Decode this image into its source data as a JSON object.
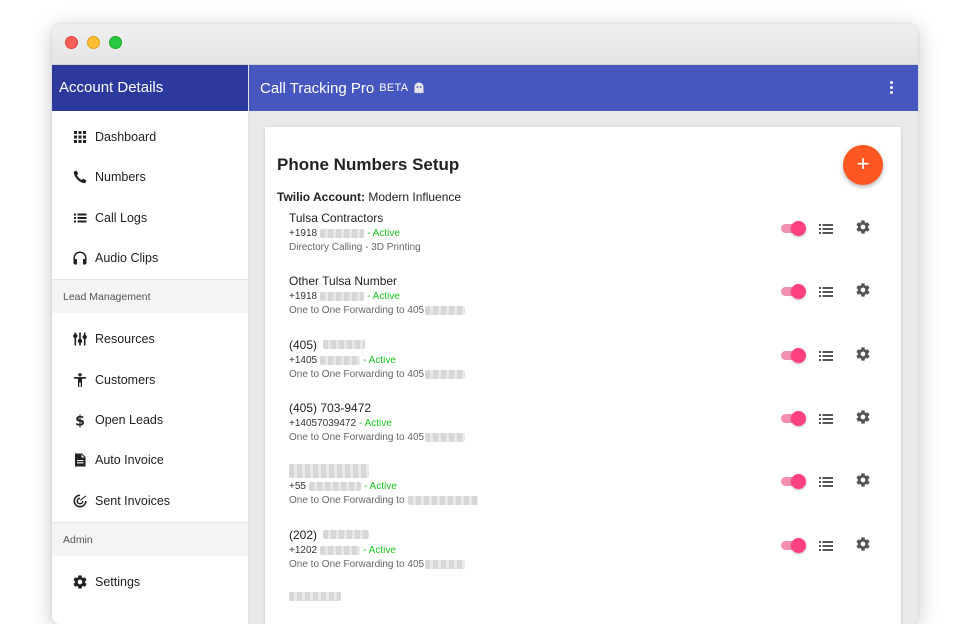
{
  "sidebar": {
    "title": "Account Details",
    "items": [
      {
        "label": "Dashboard",
        "icon": "grid-icon"
      },
      {
        "label": "Numbers",
        "icon": "phone-icon"
      },
      {
        "label": "Call Logs",
        "icon": "list-icon"
      },
      {
        "label": "Audio Clips",
        "icon": "headphones-icon"
      }
    ],
    "section_lead": "Lead Management",
    "lead_items": [
      {
        "label": "Resources",
        "icon": "sliders-icon"
      },
      {
        "label": "Customers",
        "icon": "person-icon"
      },
      {
        "label": "Open Leads",
        "icon": "dollar-icon"
      },
      {
        "label": "Auto Invoice",
        "icon": "document-icon"
      },
      {
        "label": "Sent Invoices",
        "icon": "track-icon"
      }
    ],
    "section_admin": "Admin",
    "admin_items": [
      {
        "label": "Settings",
        "icon": "gear-icon"
      }
    ]
  },
  "appbar": {
    "title": "Call Tracking Pro",
    "beta": "BETA"
  },
  "card": {
    "title": "Phone Numbers Setup",
    "fab_label": "+",
    "account_label": "Twilio Account:",
    "account_value": "Modern Influence"
  },
  "numbers": [
    {
      "name": "Tulsa Contractors",
      "number": "+1918",
      "status": "- Active",
      "desc": "Directory Calling - 3D Printing"
    },
    {
      "name": "Other Tulsa Number",
      "number": "+1918",
      "status": "- Active",
      "desc": "One to One Forwarding to 405"
    },
    {
      "name": "(405)",
      "number": "+1405",
      "status": "- Active",
      "desc": "One to One Forwarding to 405"
    },
    {
      "name": "(405) 703-9472",
      "number": "+14057039472",
      "status": "- Active",
      "desc": "One to One Forwarding to 405"
    },
    {
      "name": "",
      "number": "+55",
      "status": "- Active",
      "desc": "One to One Forwarding to"
    },
    {
      "name": "(202)",
      "number": "+1202",
      "status": "- Active",
      "desc": "One to One Forwarding to 405"
    }
  ],
  "colors": {
    "sidebar_header": "#2c3a9e",
    "appbar": "#4658c0",
    "fab": "#ff5722",
    "toggle": "#ff4081",
    "active_status": "#19c21e"
  }
}
